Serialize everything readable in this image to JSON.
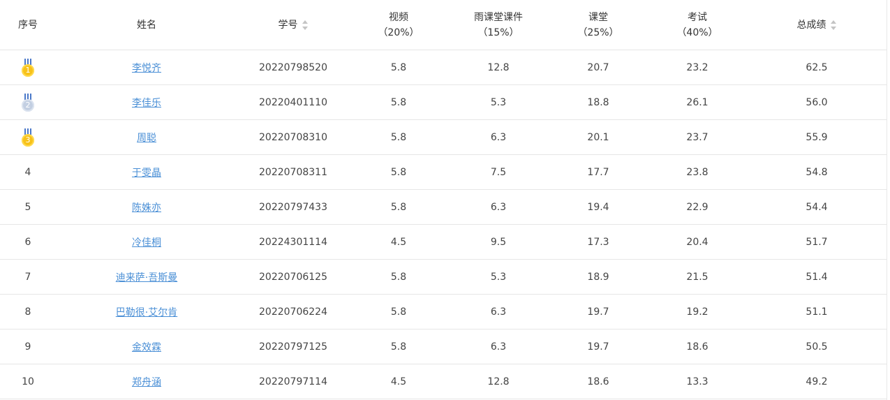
{
  "columns": {
    "rank": "序号",
    "name": "姓名",
    "student_id": "学号",
    "video": {
      "title": "视频",
      "weight": "（20%）"
    },
    "yuketang": {
      "title": "雨课堂课件",
      "weight": "（15%）"
    },
    "classroom": {
      "title": "课堂",
      "weight": "（25%）"
    },
    "exam": {
      "title": "考试",
      "weight": "（40%）"
    },
    "total": "总成绩"
  },
  "rows": [
    {
      "rank": "1",
      "medal": "gold",
      "name": "李悦齐",
      "student_id": "20220798520",
      "video": "5.8",
      "yuketang": "12.8",
      "classroom": "20.7",
      "exam": "23.2",
      "total": "62.5"
    },
    {
      "rank": "2",
      "medal": "silver",
      "name": "李佳乐",
      "student_id": "20220401110",
      "video": "5.8",
      "yuketang": "5.3",
      "classroom": "18.8",
      "exam": "26.1",
      "total": "56.0"
    },
    {
      "rank": "3",
      "medal": "gold",
      "name": "周聪",
      "student_id": "20220708310",
      "video": "5.8",
      "yuketang": "6.3",
      "classroom": "20.1",
      "exam": "23.7",
      "total": "55.9"
    },
    {
      "rank": "4",
      "name": "于雯晶",
      "student_id": "20220708311",
      "video": "5.8",
      "yuketang": "7.5",
      "classroom": "17.7",
      "exam": "23.8",
      "total": "54.8"
    },
    {
      "rank": "5",
      "name": "陈姝亦",
      "student_id": "20220797433",
      "video": "5.8",
      "yuketang": "6.3",
      "classroom": "19.4",
      "exam": "22.9",
      "total": "54.4"
    },
    {
      "rank": "6",
      "name": "冷佳桐",
      "student_id": "20224301114",
      "video": "4.5",
      "yuketang": "9.5",
      "classroom": "17.3",
      "exam": "20.4",
      "total": "51.7"
    },
    {
      "rank": "7",
      "name": "迪来萨·吾斯曼",
      "student_id": "20220706125",
      "video": "5.8",
      "yuketang": "5.3",
      "classroom": "18.9",
      "exam": "21.5",
      "total": "51.4"
    },
    {
      "rank": "8",
      "name": "巴勒很·艾尔肯",
      "student_id": "20220706224",
      "video": "5.8",
      "yuketang": "6.3",
      "classroom": "19.7",
      "exam": "19.2",
      "total": "51.1"
    },
    {
      "rank": "9",
      "name": "金效霖",
      "student_id": "20220797125",
      "video": "5.8",
      "yuketang": "6.3",
      "classroom": "19.7",
      "exam": "18.6",
      "total": "50.5"
    },
    {
      "rank": "10",
      "name": "郑舟涵",
      "student_id": "20220797114",
      "video": "4.5",
      "yuketang": "12.8",
      "classroom": "18.6",
      "exam": "13.3",
      "total": "49.2"
    }
  ],
  "colors": {
    "link": "#4a8fd6",
    "gold": "#f7c21a",
    "silver": "#c3cfe2",
    "border": "#e6e6e6"
  },
  "icons": {
    "sort": "sort-caret-icon",
    "medal": "medal-icon"
  }
}
